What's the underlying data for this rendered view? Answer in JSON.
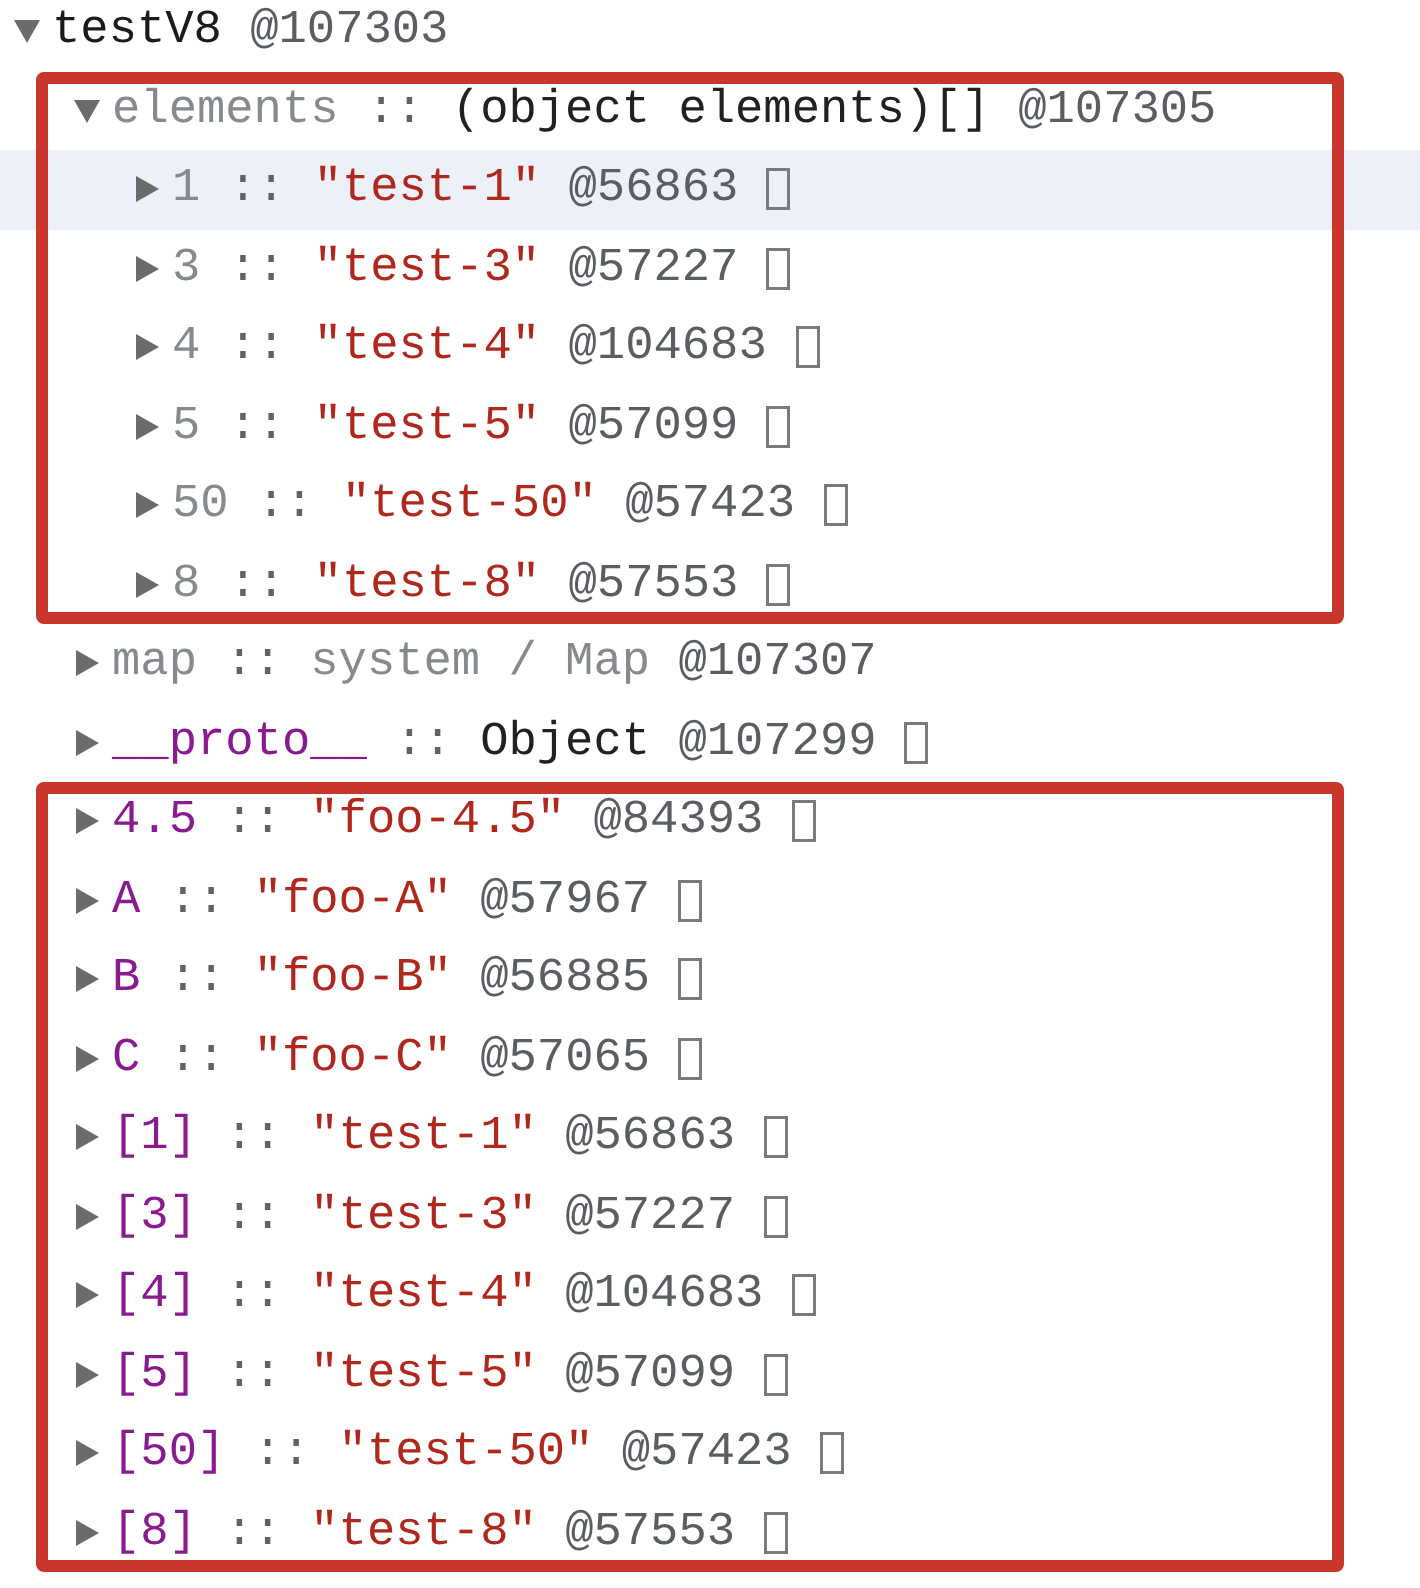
{
  "tree": {
    "key": {
      "text": "testV8",
      "kind": "root"
    },
    "id": "@107303",
    "expanded": true,
    "selected": false,
    "reveal_icon": false,
    "children": [
      {
        "key": {
          "text": "elements",
          "kind": "internal"
        },
        "separator": "::",
        "value": {
          "text": "(object elements)[]",
          "kind": "object"
        },
        "id": "@107305",
        "expanded": true,
        "selected": false,
        "reveal_icon": false,
        "framed": true,
        "children": [
          {
            "key": {
              "text": "1",
              "kind": "internal"
            },
            "separator": "::",
            "value": {
              "text": "\"test-1\"",
              "kind": "string"
            },
            "id": "@56863",
            "expanded": false,
            "selected": true,
            "reveal_icon": true
          },
          {
            "key": {
              "text": "3",
              "kind": "internal"
            },
            "separator": "::",
            "value": {
              "text": "\"test-3\"",
              "kind": "string"
            },
            "id": "@57227",
            "expanded": false,
            "selected": false,
            "reveal_icon": true
          },
          {
            "key": {
              "text": "4",
              "kind": "internal"
            },
            "separator": "::",
            "value": {
              "text": "\"test-4\"",
              "kind": "string"
            },
            "id": "@104683",
            "expanded": false,
            "selected": false,
            "reveal_icon": true
          },
          {
            "key": {
              "text": "5",
              "kind": "internal"
            },
            "separator": "::",
            "value": {
              "text": "\"test-5\"",
              "kind": "string"
            },
            "id": "@57099",
            "expanded": false,
            "selected": false,
            "reveal_icon": true
          },
          {
            "key": {
              "text": "50",
              "kind": "internal"
            },
            "separator": "::",
            "value": {
              "text": "\"test-50\"",
              "kind": "string"
            },
            "id": "@57423",
            "expanded": false,
            "selected": false,
            "reveal_icon": true
          },
          {
            "key": {
              "text": "8",
              "kind": "internal"
            },
            "separator": "::",
            "value": {
              "text": "\"test-8\"",
              "kind": "string"
            },
            "id": "@57553",
            "expanded": false,
            "selected": false,
            "reveal_icon": true
          }
        ]
      },
      {
        "key": {
          "text": "map",
          "kind": "internal"
        },
        "separator": "::",
        "value": {
          "text": "system / Map",
          "kind": "system"
        },
        "id": "@107307",
        "expanded": false,
        "selected": false,
        "reveal_icon": false,
        "framed": false
      },
      {
        "key": {
          "text": "__proto__",
          "kind": "property"
        },
        "separator": "::",
        "value": {
          "text": "Object",
          "kind": "object"
        },
        "id": "@107299",
        "expanded": false,
        "selected": false,
        "reveal_icon": true,
        "framed": false
      },
      {
        "key": {
          "text": "4.5",
          "kind": "property"
        },
        "separator": "::",
        "value": {
          "text": "\"foo-4.5\"",
          "kind": "string"
        },
        "id": "@84393",
        "expanded": false,
        "selected": false,
        "reveal_icon": true,
        "framed": true
      },
      {
        "key": {
          "text": "A",
          "kind": "property"
        },
        "separator": "::",
        "value": {
          "text": "\"foo-A\"",
          "kind": "string"
        },
        "id": "@57967",
        "expanded": false,
        "selected": false,
        "reveal_icon": true,
        "framed": true
      },
      {
        "key": {
          "text": "B",
          "kind": "property"
        },
        "separator": "::",
        "value": {
          "text": "\"foo-B\"",
          "kind": "string"
        },
        "id": "@56885",
        "expanded": false,
        "selected": false,
        "reveal_icon": true,
        "framed": true
      },
      {
        "key": {
          "text": "C",
          "kind": "property"
        },
        "separator": "::",
        "value": {
          "text": "\"foo-C\"",
          "kind": "string"
        },
        "id": "@57065",
        "expanded": false,
        "selected": false,
        "reveal_icon": true,
        "framed": true
      },
      {
        "key": {
          "text": "[1]",
          "kind": "property"
        },
        "separator": "::",
        "value": {
          "text": "\"test-1\"",
          "kind": "string"
        },
        "id": "@56863",
        "expanded": false,
        "selected": false,
        "reveal_icon": true,
        "framed": true
      },
      {
        "key": {
          "text": "[3]",
          "kind": "property"
        },
        "separator": "::",
        "value": {
          "text": "\"test-3\"",
          "kind": "string"
        },
        "id": "@57227",
        "expanded": false,
        "selected": false,
        "reveal_icon": true,
        "framed": true
      },
      {
        "key": {
          "text": "[4]",
          "kind": "property"
        },
        "separator": "::",
        "value": {
          "text": "\"test-4\"",
          "kind": "string"
        },
        "id": "@104683",
        "expanded": false,
        "selected": false,
        "reveal_icon": true,
        "framed": true
      },
      {
        "key": {
          "text": "[5]",
          "kind": "property"
        },
        "separator": "::",
        "value": {
          "text": "\"test-5\"",
          "kind": "string"
        },
        "id": "@57099",
        "expanded": false,
        "selected": false,
        "reveal_icon": true,
        "framed": true
      },
      {
        "key": {
          "text": "[50]",
          "kind": "property"
        },
        "separator": "::",
        "value": {
          "text": "\"test-50\"",
          "kind": "string"
        },
        "id": "@57423",
        "expanded": false,
        "selected": false,
        "reveal_icon": true,
        "framed": true
      },
      {
        "key": {
          "text": "[8]",
          "kind": "property"
        },
        "separator": "::",
        "value": {
          "text": "\"test-8\"",
          "kind": "string"
        },
        "id": "@57553",
        "expanded": false,
        "selected": false,
        "reveal_icon": true,
        "framed": true
      }
    ]
  }
}
